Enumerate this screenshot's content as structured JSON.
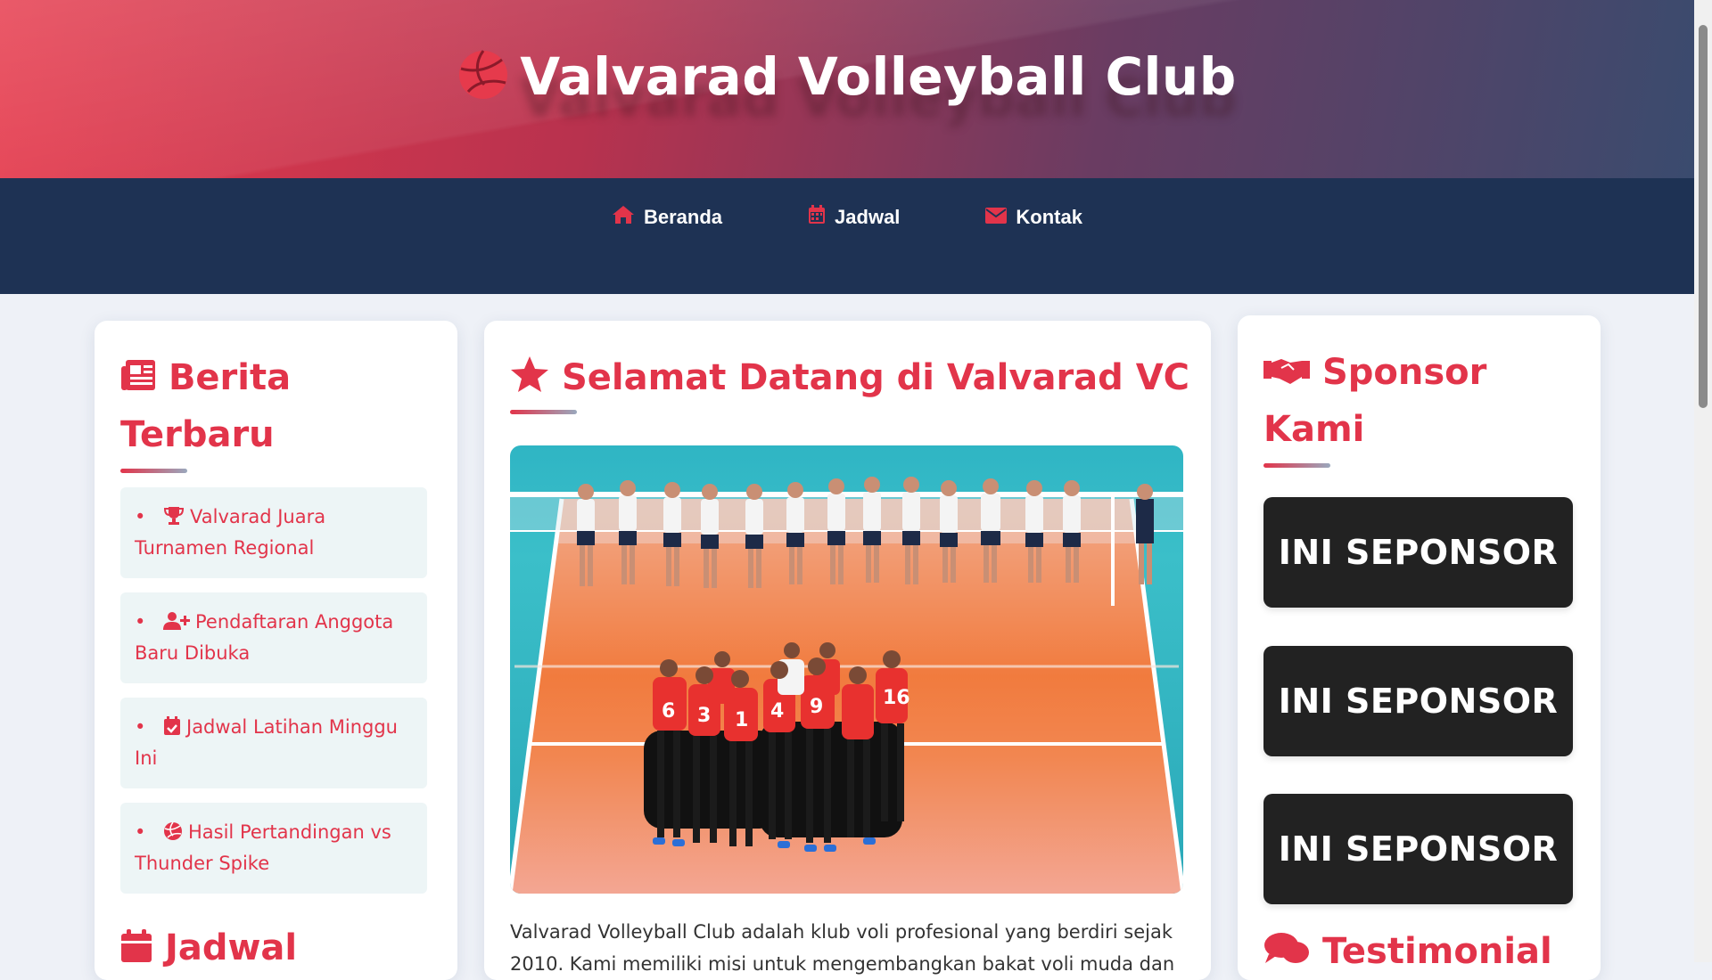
{
  "site": {
    "title": "Valvarad Volleyball Club"
  },
  "nav": {
    "items": [
      {
        "label": "Beranda",
        "icon": "home-icon"
      },
      {
        "label": "Jadwal",
        "icon": "calendar-icon"
      },
      {
        "label": "Kontak",
        "icon": "envelope-icon"
      }
    ]
  },
  "news": {
    "title_line1": "Berita",
    "title_line2": "Terbaru",
    "items": [
      {
        "label": "Valvarad Juara Turnamen Regional",
        "icon": "trophy-icon"
      },
      {
        "label": "Pendaftaran Anggota Baru Dibuka",
        "icon": "user-plus-icon"
      },
      {
        "label": "Jadwal Latihan Minggu Ini",
        "icon": "calendar-check-icon"
      },
      {
        "label": "Hasil Pertandingan vs Thunder Spike",
        "icon": "volleyball-icon"
      }
    ]
  },
  "schedule": {
    "title": "Jadwal"
  },
  "main": {
    "title": "Selamat Datang di Valvarad VC",
    "intro_line1": "Valvarad Volleyball Club adalah klub voli profesional yang berdiri sejak",
    "intro_line2": "2010. Kami memiliki misi untuk mengembangkan bakat voli muda dan"
  },
  "sponsors": {
    "title_line1": "Sponsor",
    "title_line2": "Kami",
    "items": [
      {
        "label": "INI SEPONSOR"
      },
      {
        "label": "INI SEPONSOR"
      },
      {
        "label": "INI SEPONSOR"
      }
    ]
  },
  "testimonials": {
    "title": "Testimonial"
  },
  "colors": {
    "accent": "#e2344a",
    "nav": "#1e3254",
    "news_bg": "#edf5f6",
    "sponsor_bg": "#222222"
  }
}
